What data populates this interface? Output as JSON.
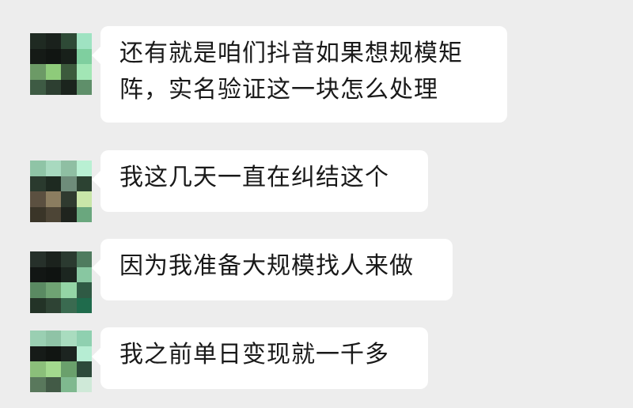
{
  "chat": {
    "messages": [
      {
        "text": "还有就是咱们抖音如果想规模矩阵，实名验证这一块怎么处理"
      },
      {
        "text": "我这几天一直在纠结这个"
      },
      {
        "text": "因为我准备大规模找人来做"
      },
      {
        "text": "我之前单日变现就一千多"
      }
    ]
  },
  "colors": {
    "background": "#ededed",
    "bubble": "#ffffff",
    "text": "#191919"
  }
}
